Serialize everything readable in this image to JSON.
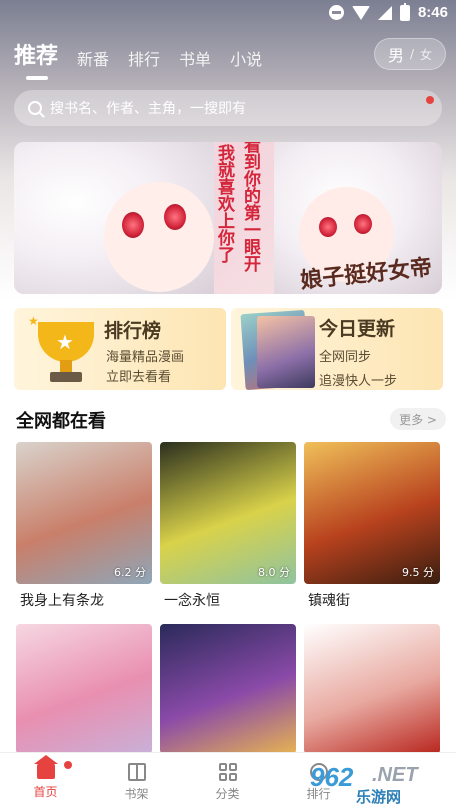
{
  "status_bar": {
    "time": "8:46"
  },
  "header": {
    "tabs": [
      {
        "label": "推荐",
        "active": true
      },
      {
        "label": "新番",
        "active": false
      },
      {
        "label": "排行",
        "active": false
      },
      {
        "label": "书单",
        "active": false
      },
      {
        "label": "小说",
        "active": false
      }
    ],
    "gender": {
      "male": "男",
      "separator": "/",
      "female": "女"
    }
  },
  "search": {
    "placeholder": "搜书名、作者、主角，一搜即有"
  },
  "banner": {
    "text_col1": "我就喜欢上你了",
    "text_col2": "看到你的第一眼开",
    "logo": "娘子挺好女帝"
  },
  "features": [
    {
      "title": "排行榜",
      "line1": "海量精品漫画",
      "line2": "立即去看看"
    },
    {
      "title": "今日更新",
      "line1": "全网同步",
      "line2": "追漫快人一步"
    }
  ],
  "section": {
    "title": "全网都在看",
    "more": "更多 >"
  },
  "comics": [
    {
      "title": "我身上有条龙",
      "score": "6.2 分",
      "colors": [
        "#d9d3cc",
        "#c97f6a",
        "#8fa6b8"
      ]
    },
    {
      "title": "一念永恒",
      "score": "8.0 分",
      "colors": [
        "#2b2f1e",
        "#d9d24a",
        "#8fc3a0"
      ]
    },
    {
      "title": "镇魂街",
      "score": "9.5 分",
      "colors": [
        "#f0c05a",
        "#b8421e",
        "#3a1e10"
      ]
    },
    {
      "title": "",
      "score": "",
      "colors": [
        "#f6d7e2",
        "#e98fb0",
        "#c9b0d8"
      ]
    },
    {
      "title": "",
      "score": "",
      "colors": [
        "#2a2a5a",
        "#8a4aa8",
        "#e6b352"
      ]
    },
    {
      "title": "",
      "score": "",
      "colors": [
        "#ffffff",
        "#e8a9a0",
        "#b8261e"
      ]
    }
  ],
  "bottom_nav": [
    {
      "label": "首页",
      "icon": "home-icon",
      "active": true
    },
    {
      "label": "书架",
      "icon": "bookshelf-icon",
      "active": false
    },
    {
      "label": "分类",
      "icon": "category-icon",
      "active": false
    },
    {
      "label": "排行",
      "icon": "rank-icon",
      "active": false
    }
  ],
  "watermark": {
    "brand": "962",
    "suffix": ".NET",
    "site": "乐游网"
  },
  "colors": {
    "accent": "#e64340",
    "score_text": "#ffffff"
  }
}
